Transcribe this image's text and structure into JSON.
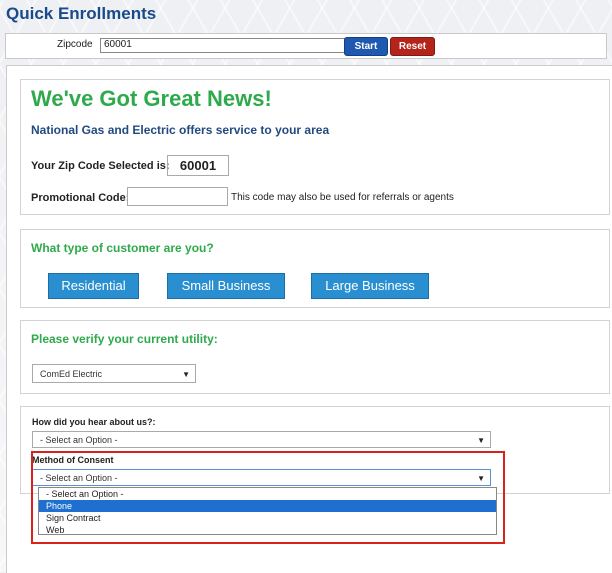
{
  "page": {
    "title": "Quick Enrollments"
  },
  "zipbar": {
    "label": "Zipcode",
    "value": "60001",
    "start_label": "Start",
    "reset_label": "Reset"
  },
  "news": {
    "title": "We've Got Great News!",
    "subtitle": "National Gas and Electric offers service to your area",
    "zip_label": "Your Zip Code Selected is:",
    "zip_value": "60001",
    "promo_label": "Promotional Code:",
    "promo_value": "",
    "promo_hint": "This code may also be used for referrals or agents"
  },
  "customer_type": {
    "heading": "What type of customer are you?",
    "options": [
      "Residential",
      "Small Business",
      "Large Business"
    ]
  },
  "utility": {
    "heading": "Please verify your current utility:",
    "selected": "ComEd Electric"
  },
  "hear_about": {
    "label": "How did you hear about us?:",
    "selected": "- Select an Option -"
  },
  "consent": {
    "label": "Method of Consent",
    "selected": "- Select an Option -",
    "options": [
      "- Select an Option -",
      "Phone",
      "Sign Contract",
      "Web"
    ],
    "highlighted_option": "Phone"
  },
  "colors": {
    "accent_green": "#2eaa4c",
    "title_blue": "#1a4a8a",
    "button_blue": "#2a8fd0",
    "start_blue": "#1f58b0",
    "reset_red": "#b3241a",
    "highlight_red": "#d9221c",
    "option_highlight": "#1e6fcf"
  },
  "icons": {
    "dropdown_arrow": "chevron-down-icon"
  }
}
